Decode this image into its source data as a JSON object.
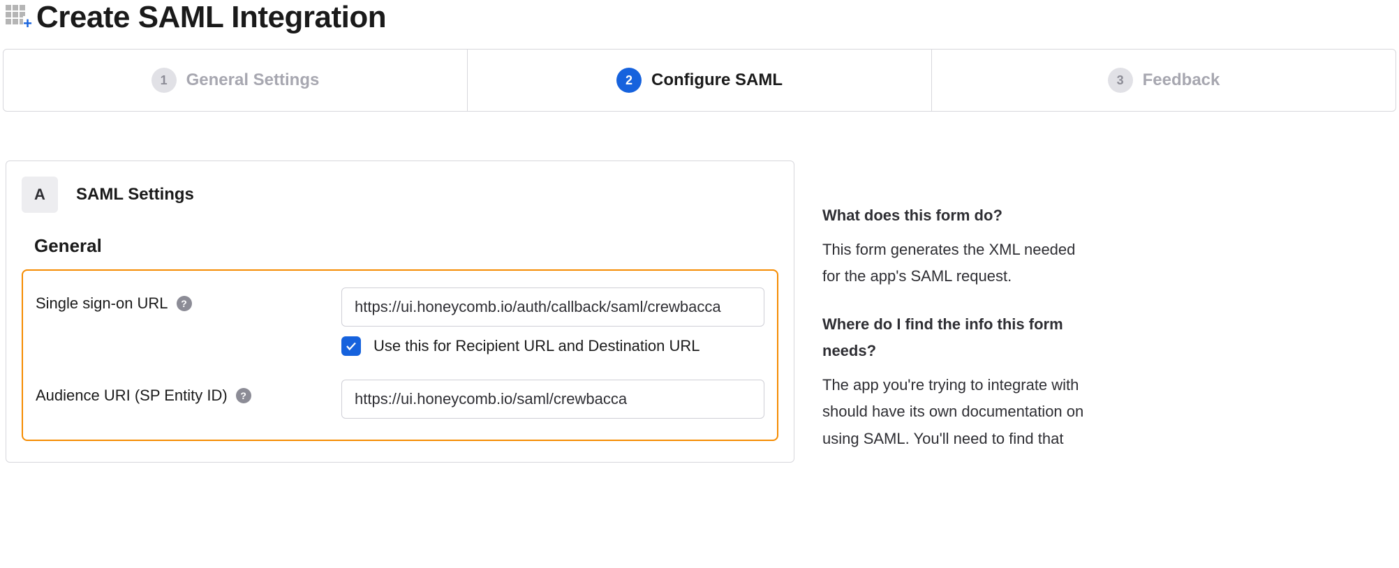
{
  "page_title": "Create SAML Integration",
  "wizard_steps": [
    {
      "num": "1",
      "label": "General Settings",
      "active": false
    },
    {
      "num": "2",
      "label": "Configure SAML",
      "active": true
    },
    {
      "num": "3",
      "label": "Feedback",
      "active": false
    }
  ],
  "section": {
    "badge": "A",
    "title": "SAML Settings",
    "subsection": "General"
  },
  "fields": {
    "sso_url": {
      "label": "Single sign-on URL",
      "value": "https://ui.honeycomb.io/auth/callback/saml/crewbacca",
      "checkbox_label": "Use this for Recipient URL and Destination URL",
      "checkbox_checked": true
    },
    "audience_uri": {
      "label": "Audience URI (SP Entity ID)",
      "value": "https://ui.honeycomb.io/saml/crewbacca"
    }
  },
  "help": {
    "q1": "What does this form do?",
    "a1": "This form generates the XML needed for the app's SAML request.",
    "q2": "Where do I find the info this form needs?",
    "a2": "The app you're trying to integrate with should have its own documentation on using SAML. You'll need to find that"
  },
  "icons": {
    "help_glyph": "?"
  }
}
